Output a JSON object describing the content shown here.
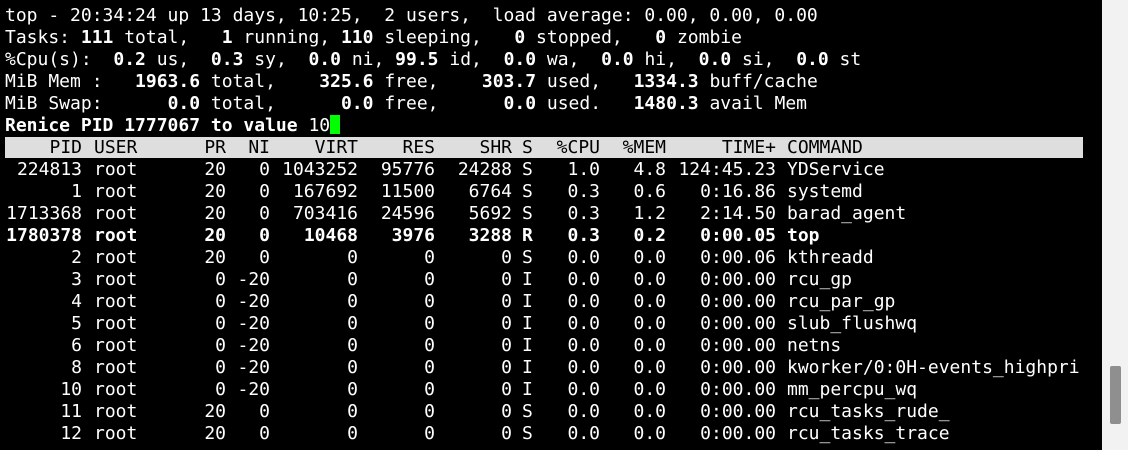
{
  "summary": {
    "line1": "top - 20:34:24 up 13 days, 10:25,  2 users,  load average: 0.00, 0.00, 0.00",
    "tasks": {
      "label": "Tasks: ",
      "total": "111",
      "total_l": " total,   ",
      "running": "1",
      "running_l": " running, ",
      "sleeping": "110",
      "sleeping_l": " sleeping,   ",
      "stopped": "0",
      "stopped_l": " stopped,   ",
      "zombie": "0",
      "zombie_l": " zombie"
    },
    "cpu": {
      "label": "%Cpu(s):  ",
      "us": "0.2",
      "us_l": " us,  ",
      "sy": "0.3",
      "sy_l": " sy,  ",
      "ni": "0.0",
      "ni_l": " ni, ",
      "id": "99.5",
      "id_l": " id,  ",
      "wa": "0.0",
      "wa_l": " wa,  ",
      "hi": "0.0",
      "hi_l": " hi,  ",
      "si": "0.0",
      "si_l": " si,  ",
      "st": "0.0",
      "st_l": " st"
    },
    "mem": {
      "label": "MiB Mem :   ",
      "total": "1963.6",
      "total_l": " total,    ",
      "free": "325.6",
      "free_l": " free,    ",
      "used": "303.7",
      "used_l": " used,   ",
      "buff": "1334.3",
      "buff_l": " buff/cache"
    },
    "swap": {
      "label": "MiB Swap:      ",
      "total": "0.0",
      "total_l": " total,      ",
      "free": "0.0",
      "free_l": " free,      ",
      "used": "0.0",
      "used_l": " used.   ",
      "avail": "1480.3",
      "avail_l": " avail Mem"
    },
    "prompt": "Renice PID 1777067 to value ",
    "prompt_input": "10"
  },
  "columns": [
    "PID",
    "USER",
    "PR",
    "NI",
    "VIRT",
    "RES",
    "SHR",
    "S",
    "%CPU",
    "%MEM",
    "TIME+",
    "COMMAND"
  ],
  "processes": [
    {
      "pid": "224813",
      "user": "root",
      "pr": "20",
      "ni": "0",
      "virt": "1043252",
      "res": "95776",
      "shr": "24288",
      "s": "S",
      "cpu": "1.0",
      "mem": "4.8",
      "time": "124:45.23",
      "cmd": "YDService",
      "bold": false
    },
    {
      "pid": "1",
      "user": "root",
      "pr": "20",
      "ni": "0",
      "virt": "167692",
      "res": "11500",
      "shr": "6764",
      "s": "S",
      "cpu": "0.3",
      "mem": "0.6",
      "time": "0:16.86",
      "cmd": "systemd",
      "bold": false
    },
    {
      "pid": "1713368",
      "user": "root",
      "pr": "20",
      "ni": "0",
      "virt": "703416",
      "res": "24596",
      "shr": "5692",
      "s": "S",
      "cpu": "0.3",
      "mem": "1.2",
      "time": "2:14.50",
      "cmd": "barad_agent",
      "bold": false
    },
    {
      "pid": "1780378",
      "user": "root",
      "pr": "20",
      "ni": "0",
      "virt": "10468",
      "res": "3976",
      "shr": "3288",
      "s": "R",
      "cpu": "0.3",
      "mem": "0.2",
      "time": "0:00.05",
      "cmd": "top",
      "bold": true
    },
    {
      "pid": "2",
      "user": "root",
      "pr": "20",
      "ni": "0",
      "virt": "0",
      "res": "0",
      "shr": "0",
      "s": "S",
      "cpu": "0.0",
      "mem": "0.0",
      "time": "0:00.06",
      "cmd": "kthreadd",
      "bold": false
    },
    {
      "pid": "3",
      "user": "root",
      "pr": "0",
      "ni": "-20",
      "virt": "0",
      "res": "0",
      "shr": "0",
      "s": "I",
      "cpu": "0.0",
      "mem": "0.0",
      "time": "0:00.00",
      "cmd": "rcu_gp",
      "bold": false
    },
    {
      "pid": "4",
      "user": "root",
      "pr": "0",
      "ni": "-20",
      "virt": "0",
      "res": "0",
      "shr": "0",
      "s": "I",
      "cpu": "0.0",
      "mem": "0.0",
      "time": "0:00.00",
      "cmd": "rcu_par_gp",
      "bold": false
    },
    {
      "pid": "5",
      "user": "root",
      "pr": "0",
      "ni": "-20",
      "virt": "0",
      "res": "0",
      "shr": "0",
      "s": "I",
      "cpu": "0.0",
      "mem": "0.0",
      "time": "0:00.00",
      "cmd": "slub_flushwq",
      "bold": false
    },
    {
      "pid": "6",
      "user": "root",
      "pr": "0",
      "ni": "-20",
      "virt": "0",
      "res": "0",
      "shr": "0",
      "s": "I",
      "cpu": "0.0",
      "mem": "0.0",
      "time": "0:00.00",
      "cmd": "netns",
      "bold": false
    },
    {
      "pid": "8",
      "user": "root",
      "pr": "0",
      "ni": "-20",
      "virt": "0",
      "res": "0",
      "shr": "0",
      "s": "I",
      "cpu": "0.0",
      "mem": "0.0",
      "time": "0:00.00",
      "cmd": "kworker/0:0H-events_highpri",
      "bold": false
    },
    {
      "pid": "10",
      "user": "root",
      "pr": "0",
      "ni": "-20",
      "virt": "0",
      "res": "0",
      "shr": "0",
      "s": "I",
      "cpu": "0.0",
      "mem": "0.0",
      "time": "0:00.00",
      "cmd": "mm_percpu_wq",
      "bold": false
    },
    {
      "pid": "11",
      "user": "root",
      "pr": "20",
      "ni": "0",
      "virt": "0",
      "res": "0",
      "shr": "0",
      "s": "S",
      "cpu": "0.0",
      "mem": "0.0",
      "time": "0:00.00",
      "cmd": "rcu_tasks_rude_",
      "bold": false
    },
    {
      "pid": "12",
      "user": "root",
      "pr": "20",
      "ni": "0",
      "virt": "0",
      "res": "0",
      "shr": "0",
      "s": "S",
      "cpu": "0.0",
      "mem": "0.0",
      "time": "0:00.00",
      "cmd": "rcu_tasks_trace",
      "bold": false
    }
  ],
  "colors": {
    "background": "#000000",
    "foreground": "#ffffff",
    "header_bar": "#dedede",
    "cursor": "#00ff00",
    "scrollbar_track": "#f2f2f2",
    "scrollbar_thumb": "#8f8f8f"
  }
}
